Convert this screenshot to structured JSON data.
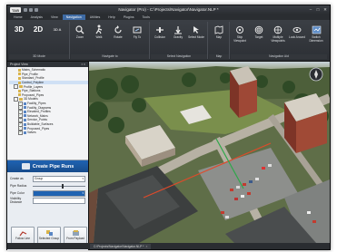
{
  "app": {
    "logo_text": "TAB",
    "title": "Navigator (Pro) - C:\\Projects\\Navigator\\Navigator.NLP *"
  },
  "window_controls": [
    "–",
    "□",
    "✕"
  ],
  "menu": {
    "tabs": [
      "Home",
      "Analysis",
      "View",
      "Navigation",
      "Utilities",
      "Help",
      "Plugins",
      "Tools"
    ],
    "active": "Navigation"
  },
  "ribbon": {
    "groups": [
      {
        "label": "3D Mode",
        "buttons": [
          "3D",
          "2D",
          "3D A"
        ]
      },
      {
        "label": "Navigate to",
        "buttons": [
          "Zoom",
          "Walk",
          "Rotate",
          "Fly To"
        ]
      },
      {
        "label": "Select Navigation",
        "buttons": [
          "Collision",
          "Gravity",
          "Select Mode"
        ]
      },
      {
        "label": "Map",
        "buttons": [
          "Map"
        ]
      },
      {
        "label": "Navigation Aid",
        "buttons": [
          "Skip Viewpoint",
          "Target",
          "Multiple Viewpoints",
          "Look Around",
          "Switch Dimension"
        ]
      }
    ]
  },
  "project_tree": {
    "header": "Project View",
    "items": [
      {
        "label": "Mains_Schematic",
        "level": 2,
        "type": "obj"
      },
      {
        "label": "Pipe_Profile",
        "level": 2,
        "type": "obj"
      },
      {
        "label": "Standard_Profile",
        "level": 2,
        "type": "obj"
      },
      {
        "label": "Control_Polyline",
        "level": 2,
        "type": "obj"
      },
      {
        "label": "Profile_Layers",
        "level": 1,
        "type": "folder"
      },
      {
        "label": "Pipe_Stations",
        "level": 2,
        "type": "obj"
      },
      {
        "label": "Proposed_Pipes",
        "level": 2,
        "type": "obj"
      },
      {
        "label": "3D Models",
        "level": 1,
        "type": "folder"
      },
      {
        "label": "Facility_Pipes",
        "level": 2,
        "type": "check"
      },
      {
        "label": "Facility_Diagrams",
        "level": 2,
        "type": "check"
      },
      {
        "label": "Elevated_Profiles",
        "level": 2,
        "type": "check"
      },
      {
        "label": "Network_Mains",
        "level": 2,
        "type": "check"
      },
      {
        "label": "Service_Points",
        "level": 2,
        "type": "check"
      },
      {
        "label": "Buildable_Surfaces",
        "level": 2,
        "type": "check"
      },
      {
        "label": "Proposed_Pipes",
        "level": 2,
        "type": "check"
      },
      {
        "label": "Valves",
        "level": 2,
        "type": "check"
      }
    ]
  },
  "pipe_panel": {
    "title": "Create Pipe Runs",
    "fields": [
      {
        "label": "Create as",
        "value": "Group"
      },
      {
        "label": "Pipe Radius",
        "value": ""
      },
      {
        "label": "Pipe Color",
        "value": ""
      },
      {
        "label": "Visibility Distance",
        "value": ""
      }
    ],
    "radius_level": 0.55,
    "buttons": [
      "Follow Line",
      "Selected Group",
      "From Payload"
    ]
  },
  "status": {
    "doc_tab": "C:\\Projects\\Navigator\\Navigator.NLP *",
    "close": "×"
  }
}
